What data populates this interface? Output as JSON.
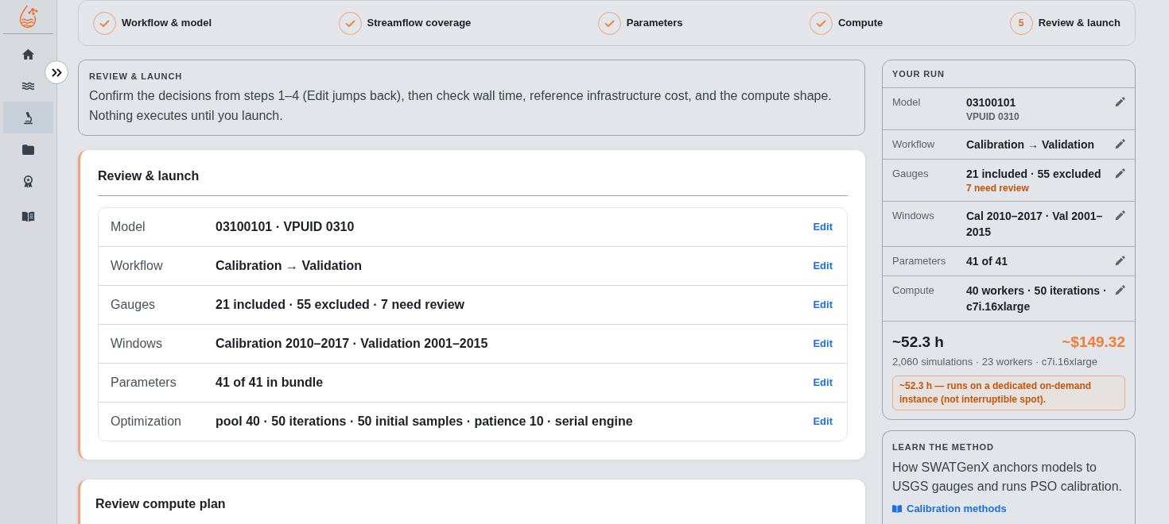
{
  "sidebar": {
    "nav_items": [
      {
        "selected": false
      },
      {
        "selected": false
      },
      {
        "selected": true
      },
      {
        "selected": false
      },
      {
        "selected": false
      },
      {
        "selected": false
      }
    ]
  },
  "stepper": {
    "steps": [
      {
        "label": "Workflow & model",
        "done": true
      },
      {
        "label": "Streamflow coverage",
        "done": true
      },
      {
        "label": "Parameters",
        "done": true
      },
      {
        "label": "Compute",
        "done": true
      },
      {
        "label": "Review & launch",
        "done": false,
        "number": "5"
      }
    ]
  },
  "intro": {
    "heading": "REVIEW & LAUNCH",
    "text": "Confirm the decisions from steps 1–4 (Edit jumps back), then check wall time, reference infrastructure cost, and the compute shape. Nothing executes until you launch."
  },
  "review_card": {
    "title": "Review & launch",
    "rows": [
      {
        "label": "Model",
        "value": "03100101 · VPUID 0310",
        "action": "Edit"
      },
      {
        "label": "Workflow",
        "value": "Calibration → Validation",
        "action": "Edit"
      },
      {
        "label": "Gauges",
        "value": "21 included · 55 excluded · 7 need review",
        "action": "Edit"
      },
      {
        "label": "Windows",
        "value": "Calibration 2010–2017 · Validation 2001–2015",
        "action": "Edit"
      },
      {
        "label": "Parameters",
        "value": "41 of 41 in bundle",
        "action": "Edit"
      },
      {
        "label": "Optimization",
        "value": "pool 40 · 50 iterations · 50 initial samples · patience 10 · serial engine",
        "action": "Edit"
      }
    ]
  },
  "compute_card": {
    "title": "Review compute plan"
  },
  "your_run": {
    "heading": "YOUR RUN",
    "rows": [
      {
        "label": "Model",
        "value": "03100101",
        "note": {
          "text": "VPUID 0310",
          "kind": "muted"
        }
      },
      {
        "label": "Workflow",
        "value": "Calibration → Validation"
      },
      {
        "label": "Gauges",
        "value": "21 included · 55 excluded",
        "note": {
          "text": "7 need review",
          "kind": "warning"
        }
      },
      {
        "label": "Windows",
        "value": "Cal 2010–2017 · Val 2001–2015"
      },
      {
        "label": "Parameters",
        "value": "41 of 41"
      },
      {
        "label": "Compute",
        "value": "40 workers · 50 iterations · c7i.16xlarge"
      }
    ],
    "duration": "~52.3 h",
    "cost": "~$149.32",
    "details": "2,060 simulations · 23 workers · c7i.16xlarge",
    "alert": "~52.3 h — runs on a dedicated on-demand instance (not interruptible spot)."
  },
  "learn": {
    "heading": "LEARN THE METHOD",
    "text": "How SWATGenX anchors models to USGS gauges and runs PSO calibration.",
    "link": "Calibration methods"
  }
}
